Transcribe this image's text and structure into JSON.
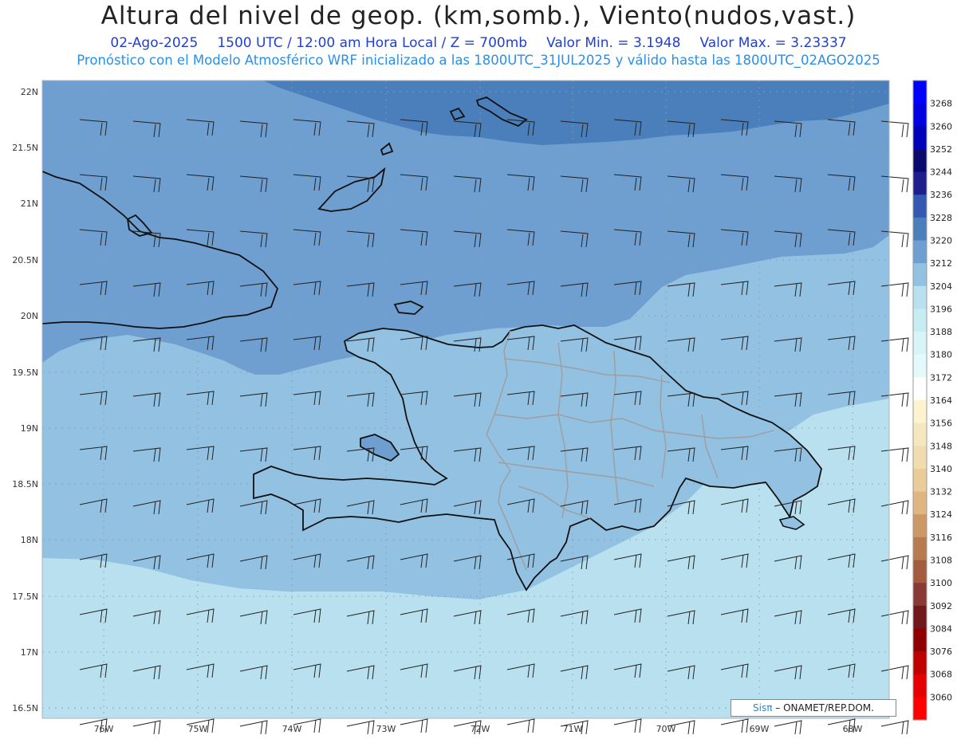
{
  "header": {
    "title": "Altura del nivel de geop. (km,somb.), Viento(nudos,vast.)",
    "date": "02-Ago-2025",
    "time": "1500 UTC / 12:00 am Hora Local / Z = 700mb",
    "min": "Valor Min. = 3.1948",
    "max": "Valor Max. = 3.23337",
    "model_line": "Pronóstico con el Modelo Atmosférico WRF inicializado a las 1800UTC_31JUL2025 y válido hasta las  1800UTC_02AGO2025"
  },
  "map": {
    "lat_labels": [
      "22N",
      "21.5N",
      "21N",
      "20.5N",
      "20N",
      "19.5N",
      "19N",
      "18.5N",
      "18N",
      "17.5N",
      "17N",
      "16.5N"
    ],
    "lon_labels": [
      "76W",
      "75W",
      "74W",
      "73W",
      "72W",
      "71W",
      "70W",
      "69W",
      "68W"
    ],
    "colors": {
      "band_dark": "#4a7fbb",
      "band_mid": "#6e9fd0",
      "band_light": "#92c1e2",
      "band_pale": "#b8e0ef",
      "coast": "#111111",
      "borders": "#9e9e9e"
    }
  },
  "colorbar": {
    "labels": [
      "3268",
      "3260",
      "3252",
      "3244",
      "3236",
      "3228",
      "3220",
      "3212",
      "3204",
      "3196",
      "3188",
      "3180",
      "3172",
      "3164",
      "3156",
      "3148",
      "3140",
      "3132",
      "3124",
      "3116",
      "3108",
      "3100",
      "3092",
      "3084",
      "3076",
      "3068",
      "3060"
    ],
    "colors": [
      "#0000ff",
      "#0000e0",
      "#0000b8",
      "#0a0a6e",
      "#1e1e8c",
      "#3559b0",
      "#4a7fbb",
      "#6e9fd0",
      "#92c1e2",
      "#b8e0ef",
      "#c8ecf4",
      "#d8f4f7",
      "#e4fafa",
      "#ffffff",
      "#fdf3d0",
      "#f7e7bf",
      "#f1dcb0",
      "#eacb9a",
      "#dfb682",
      "#cc9866",
      "#b87b50",
      "#a35c40",
      "#8a3a36",
      "#70181c",
      "#8e0000",
      "#c00000",
      "#e40000",
      "#ff0000"
    ]
  },
  "credit": {
    "sis": "Sisπ",
    "text": "– ONAMET/REP.DOM."
  }
}
